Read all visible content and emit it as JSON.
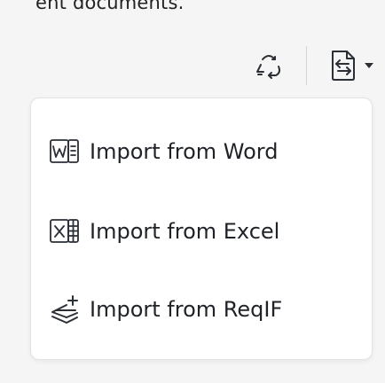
{
  "background_fragment": {
    "text": "ent documents."
  },
  "toolbar": {
    "recycle_icon": "recycle-icon",
    "import_icon": "import-document-icon",
    "caret_icon": "caret-down-icon"
  },
  "import_menu": {
    "items": [
      {
        "label": "Import from Word",
        "icon": "word-file-icon"
      },
      {
        "label": "Import from Excel",
        "icon": "excel-file-icon"
      },
      {
        "label": "Import from ReqIF",
        "icon": "reqif-layers-icon"
      }
    ]
  },
  "colors": {
    "background": "#f5f5f6",
    "menu_background": "#ffffff",
    "icon": "#2b2f36",
    "text": "#1f2328"
  }
}
